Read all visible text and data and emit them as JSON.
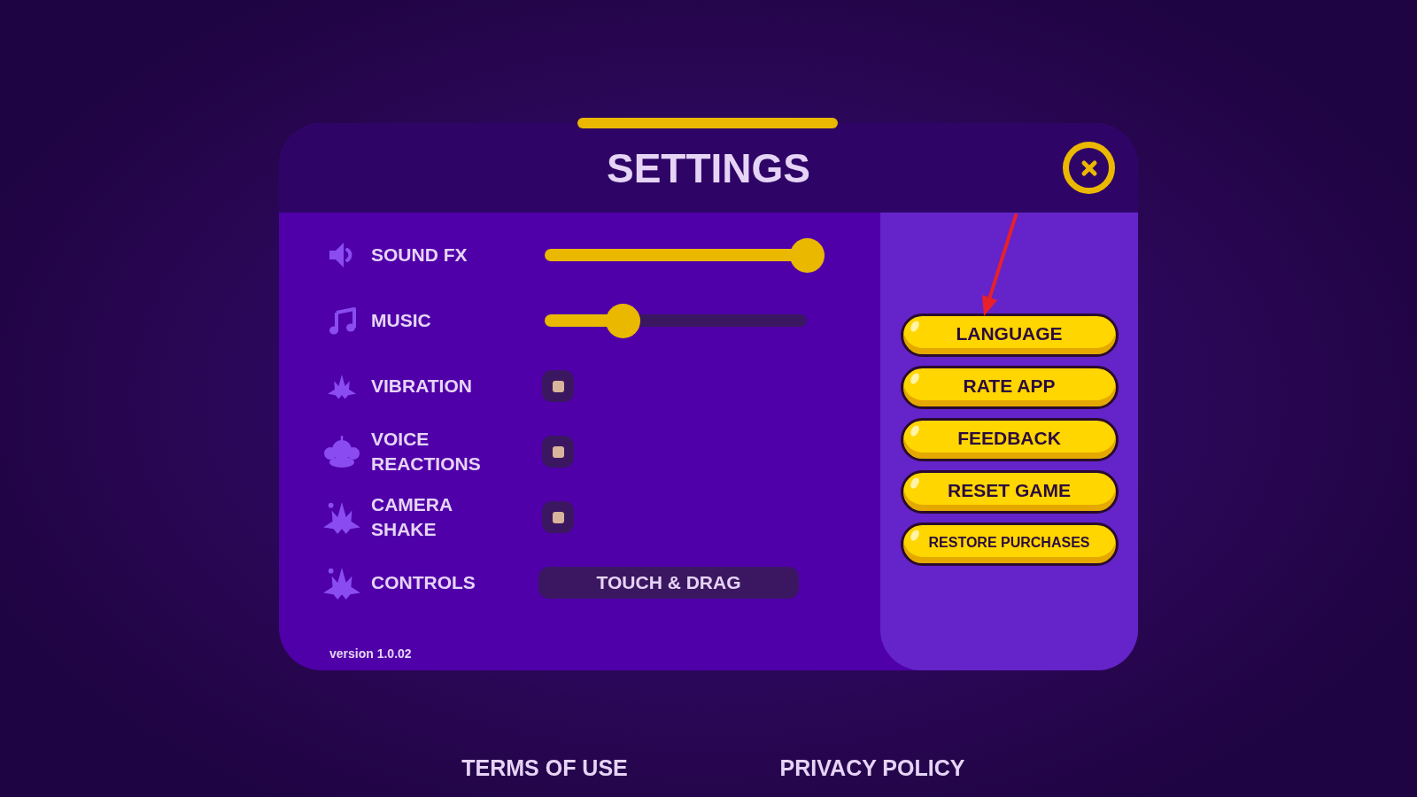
{
  "header": {
    "title": "SETTINGS"
  },
  "settings": [
    {
      "kind": "slider",
      "label": "SOUND FX",
      "level": 1.0
    },
    {
      "kind": "slider",
      "label": "MUSIC",
      "level": 0.3
    },
    {
      "kind": "toggle",
      "label": "VIBRATION",
      "checked": true
    },
    {
      "kind": "toggle",
      "label": "VOICE REACTIONS",
      "checked": true
    },
    {
      "kind": "toggle",
      "label": "CAMERA SHAKE",
      "checked": true
    },
    {
      "kind": "select",
      "label": "CONTROLS",
      "value": "TOUCH & DRAG"
    }
  ],
  "version": "version 1.0.02",
  "menu_buttons": [
    "LANGUAGE",
    "RATE APP",
    "FEEDBACK",
    "RESET GAME",
    "RESTORE PURCHASES"
  ],
  "footer_links": [
    "TERMS OF USE",
    "PRIVACY POLICY"
  ]
}
